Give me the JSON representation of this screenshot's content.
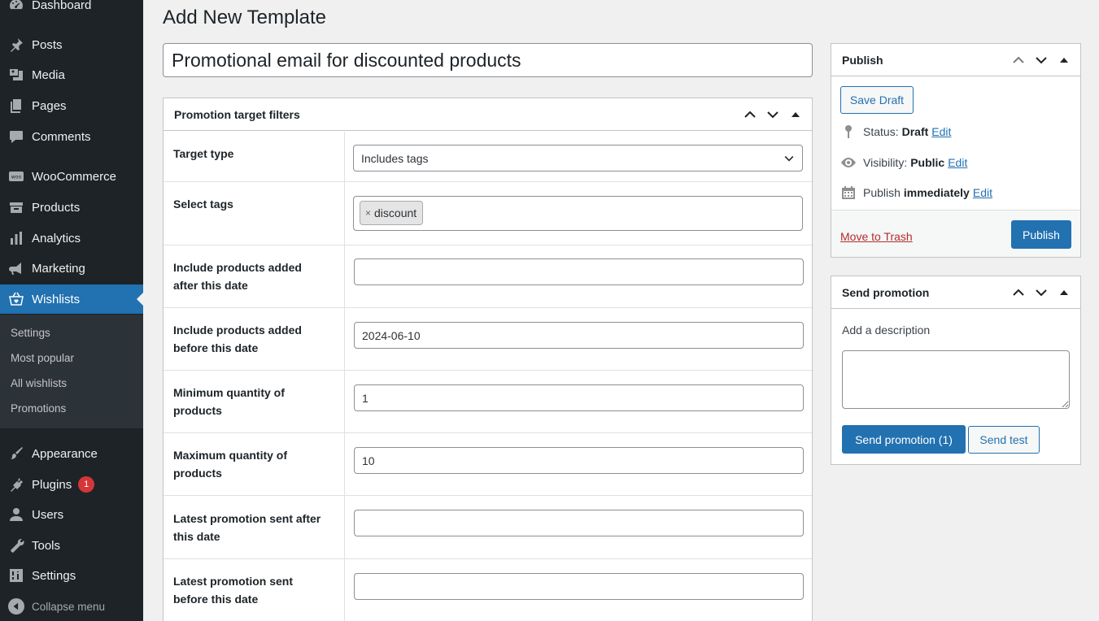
{
  "sidebar": {
    "items": [
      {
        "label": "Dashboard",
        "icon": "dashboard-icon"
      },
      {
        "label": "Posts",
        "icon": "pin-icon"
      },
      {
        "label": "Media",
        "icon": "media-icon"
      },
      {
        "label": "Pages",
        "icon": "pages-icon"
      },
      {
        "label": "Comments",
        "icon": "comments-icon"
      },
      {
        "label": "WooCommerce",
        "icon": "woocommerce-icon"
      },
      {
        "label": "Products",
        "icon": "products-icon"
      },
      {
        "label": "Analytics",
        "icon": "analytics-icon"
      },
      {
        "label": "Marketing",
        "icon": "megaphone-icon"
      },
      {
        "label": "Wishlists",
        "icon": "basket-heart-icon"
      },
      {
        "label": "Appearance",
        "icon": "paintbrush-icon"
      },
      {
        "label": "Plugins",
        "icon": "plugin-icon",
        "badge": "1"
      },
      {
        "label": "Users",
        "icon": "users-icon"
      },
      {
        "label": "Tools",
        "icon": "wrench-icon"
      },
      {
        "label": "Settings",
        "icon": "settings-icon"
      }
    ],
    "submenu": [
      "Settings",
      "Most popular",
      "All wishlists",
      "Promotions"
    ],
    "collapse_label": "Collapse menu"
  },
  "page": {
    "title": "Add New Template",
    "post_title": "Promotional email for discounted products"
  },
  "filters": {
    "title": "Promotion target filters",
    "target_type_label": "Target type",
    "target_type_value": "Includes tags",
    "select_tags_label": "Select tags",
    "tags": [
      "discount"
    ],
    "tag_remove": "×",
    "added_after_label": "Include products added after this date",
    "added_after_value": "",
    "added_before_label": "Include products added before this date",
    "added_before_value": "2024-06-10",
    "min_qty_label": "Minimum quantity of products",
    "min_qty_value": "1",
    "max_qty_label": "Maximum quantity of products",
    "max_qty_value": "10",
    "sent_after_label": "Latest promotion sent after this date",
    "sent_after_value": "",
    "sent_before_label": "Latest promotion sent before this date",
    "sent_before_value": ""
  },
  "publish": {
    "title": "Publish",
    "save_draft": "Save Draft",
    "status_label": "Status:",
    "status_value": "Draft",
    "visibility_label": "Visibility:",
    "visibility_value": "Public",
    "publish_label": "Publish",
    "publish_value": "immediately",
    "edit": "Edit",
    "trash": "Move to Trash",
    "publish_button": "Publish"
  },
  "send": {
    "title": "Send promotion",
    "description_label": "Add a description",
    "send_button": "Send promotion (1)",
    "test_button": "Send test"
  },
  "colors": {
    "admin_bar": "#1d2327",
    "submenu_bg": "#2c3338",
    "accent": "#2271b1",
    "badge": "#d63638",
    "trash": "#b32d2e"
  }
}
